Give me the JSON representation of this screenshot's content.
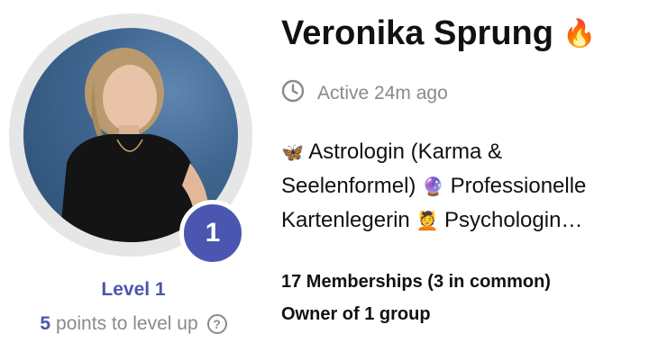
{
  "profile": {
    "name": "Veronika Sprung",
    "name_emoji": "🔥",
    "active_status": "Active 24m ago",
    "bio_parts": [
      {
        "emoji": "🦋",
        "text": " Astrologin (Karma & Seelenformel) "
      },
      {
        "emoji": "🔮",
        "text": " Professionelle Kartenlegerin "
      },
      {
        "emoji": "💆",
        "text": " Psychologin…"
      }
    ],
    "memberships": "17 Memberships (3 in common)",
    "owner": "Owner of 1 group"
  },
  "level": {
    "badge_number": "1",
    "label": "Level 1",
    "points": "5",
    "points_suffix": "points to level up",
    "help_glyph": "?"
  },
  "colors": {
    "accent": "#4a56b0",
    "muted": "#8a8a8a",
    "ring": "#e6e6e6",
    "photo_bg": "#3f6690"
  },
  "icons": {
    "clock": "clock-icon",
    "help": "help-icon",
    "flame": "flame-icon"
  }
}
